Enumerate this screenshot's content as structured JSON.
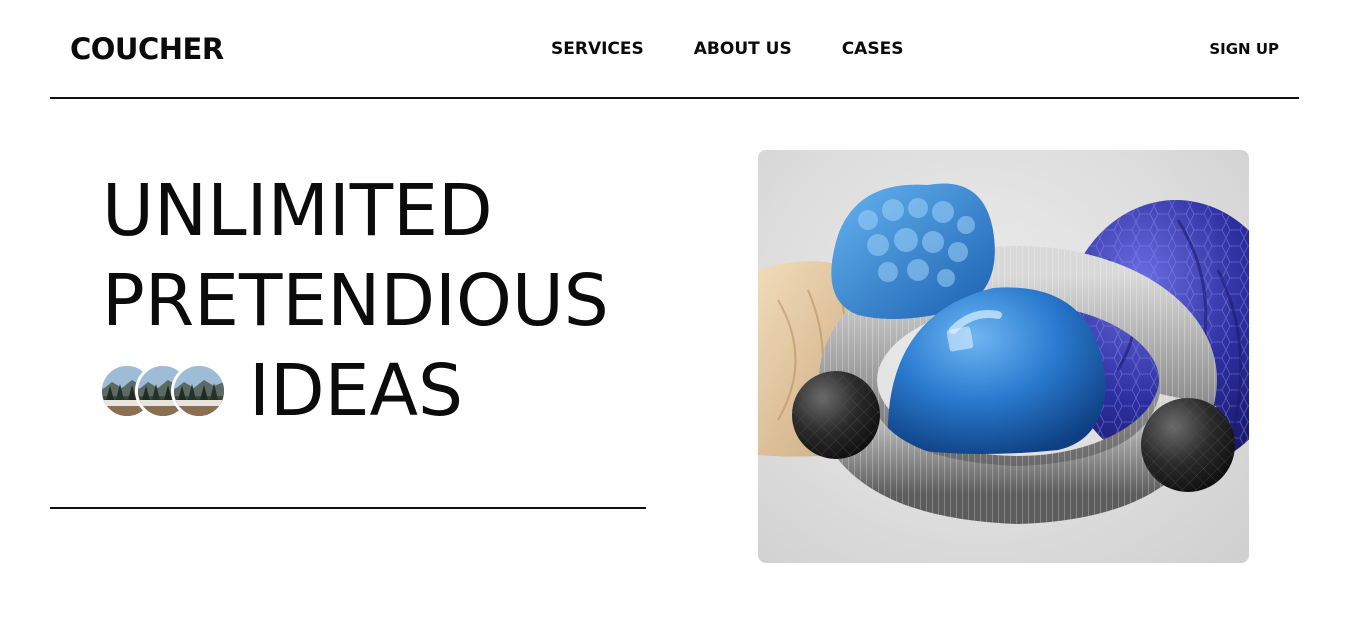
{
  "header": {
    "logo": "COUCHER",
    "nav": [
      {
        "label": "SERVICES"
      },
      {
        "label": "ABOUT US"
      },
      {
        "label": "CASES"
      }
    ],
    "signup_label": "SIGN UP"
  },
  "hero": {
    "title_line_1": "UNLIMITED",
    "title_line_2": "PRETENDIOUS",
    "title_line_3": "IDEAS",
    "avatar_count": 3
  },
  "colors": {
    "text": "#0b0b0b",
    "background": "#ffffff",
    "blue_shape": "#2a7bd0",
    "navy_shape": "#2e2fa0",
    "silver_ring": "#9a9a9a",
    "beige_shape": "#e6cda8"
  }
}
